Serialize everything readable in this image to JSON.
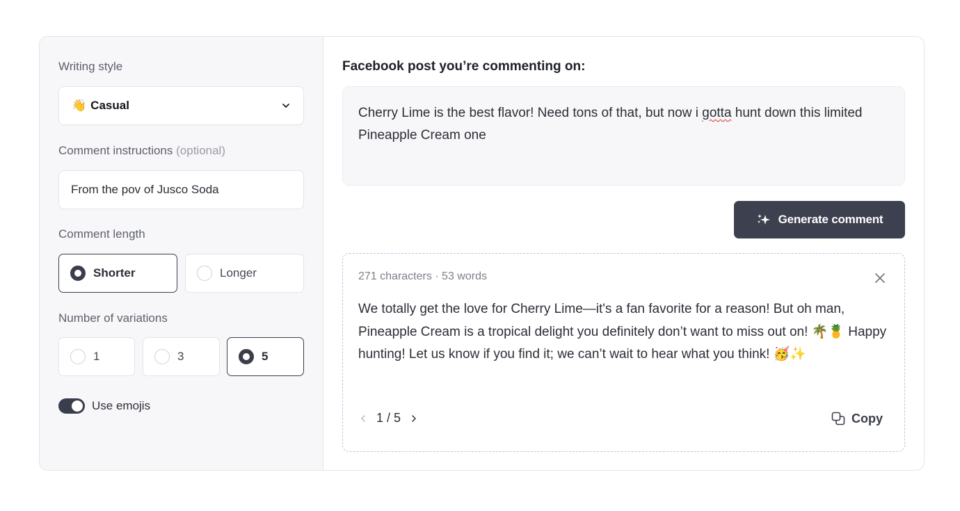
{
  "settings": {
    "writing_style_label": "Writing style",
    "writing_style": {
      "emoji": "👋",
      "value": "Casual"
    },
    "instructions_label": "Comment instructions",
    "instructions_optional": "(optional)",
    "instructions_value": "From the pov of Jusco Soda",
    "length_label": "Comment length",
    "length_options": [
      {
        "label": "Shorter",
        "selected": true
      },
      {
        "label": "Longer",
        "selected": false
      }
    ],
    "variations_label": "Number of variations",
    "variation_options": [
      {
        "label": "1",
        "selected": false
      },
      {
        "label": "3",
        "selected": false
      },
      {
        "label": "5",
        "selected": true
      }
    ],
    "use_emojis_label": "Use emojis",
    "use_emojis": true
  },
  "post": {
    "title": "Facebook post you’re commenting on:",
    "text_before": "Cherry Lime is the best flavor! Need tons of that, but now i ",
    "misspelled": "gotta",
    "text_after": " hunt down this limited Pineapple Cream one"
  },
  "generate_button": "Generate comment",
  "result": {
    "stats": "271 characters · 53 words",
    "text": "We totally get the love for Cherry Lime—it's a fan favorite for a reason! But oh man, Pineapple Cream is a tropical delight you definitely don’t want to miss out on! 🌴🍍 Happy hunting! Let us know if you find it; we can’t wait to hear what you think! 🥳✨",
    "page_current": 1,
    "page_total": 5,
    "pager_text": "1 / 5",
    "copy_label": "Copy"
  },
  "colors": {
    "accent_dark": "#3d404e",
    "panel_bg": "#f7f7f9",
    "dashed_border": "#c9bde6"
  }
}
